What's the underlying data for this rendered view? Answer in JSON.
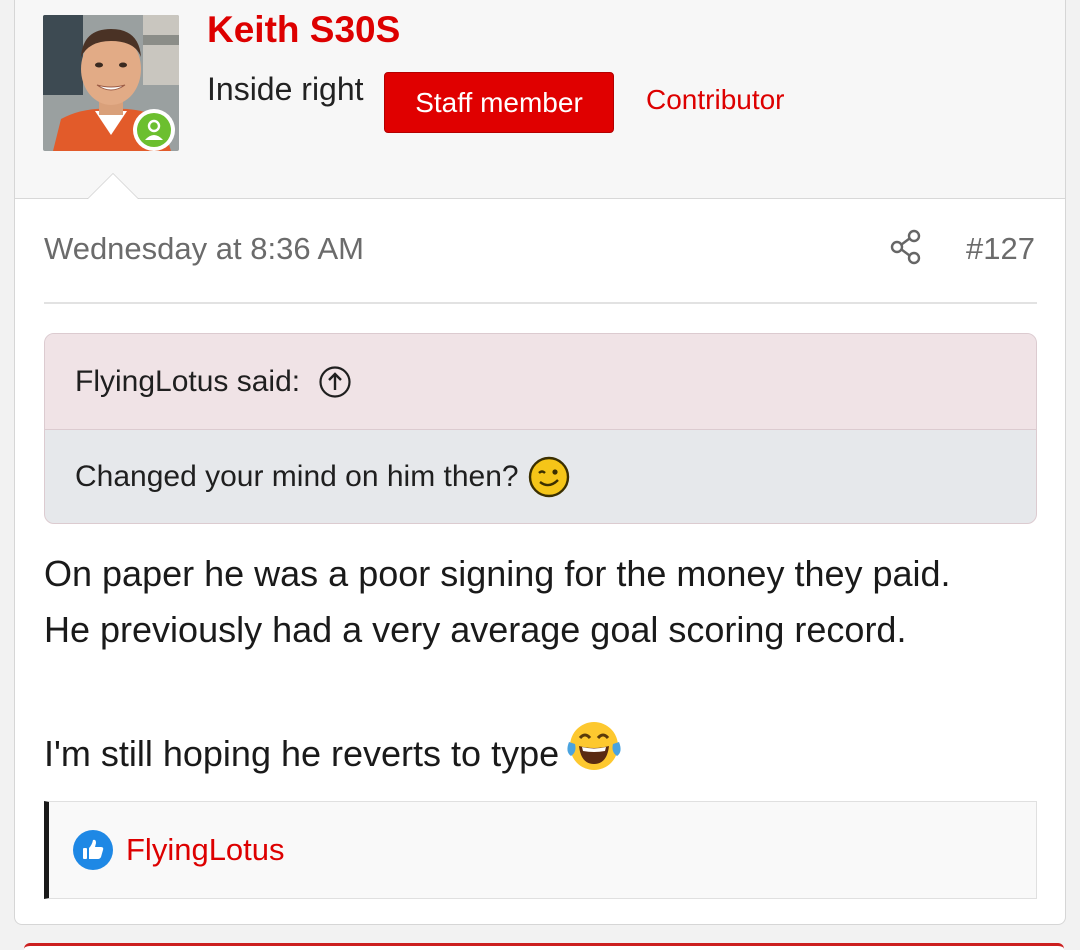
{
  "author": {
    "name": "Keith S30S",
    "title": "Inside right",
    "staff_badge": "Staff member",
    "role": "Contributor",
    "online": true
  },
  "post": {
    "date": "Wednesday at 8:36 AM",
    "number": "#127",
    "quote": {
      "attribution": "FlyingLotus said:",
      "text": "Changed your mind on him then?"
    },
    "message": {
      "line1": "On paper he was a poor signing for the money they paid.",
      "line2": "He previously had a very average goal scoring record.",
      "line3": "I'm still hoping he reverts to type"
    },
    "reactions": {
      "users": "FlyingLotus"
    }
  },
  "colors": {
    "accent": "#dd0000",
    "badge_bg": "#e00000",
    "online": "#6cbf2f",
    "like": "#1e88e5",
    "quote_head_bg": "#f0e3e6",
    "quote_body_bg": "#e6e8eb"
  },
  "icons": {
    "share": "share-icon",
    "quote_up": "arrow-up-circle-icon",
    "wink": "wink-emoji-icon",
    "laugh": "tears-of-joy-emoji-icon",
    "like": "thumbs-up-icon",
    "online": "person-icon"
  }
}
